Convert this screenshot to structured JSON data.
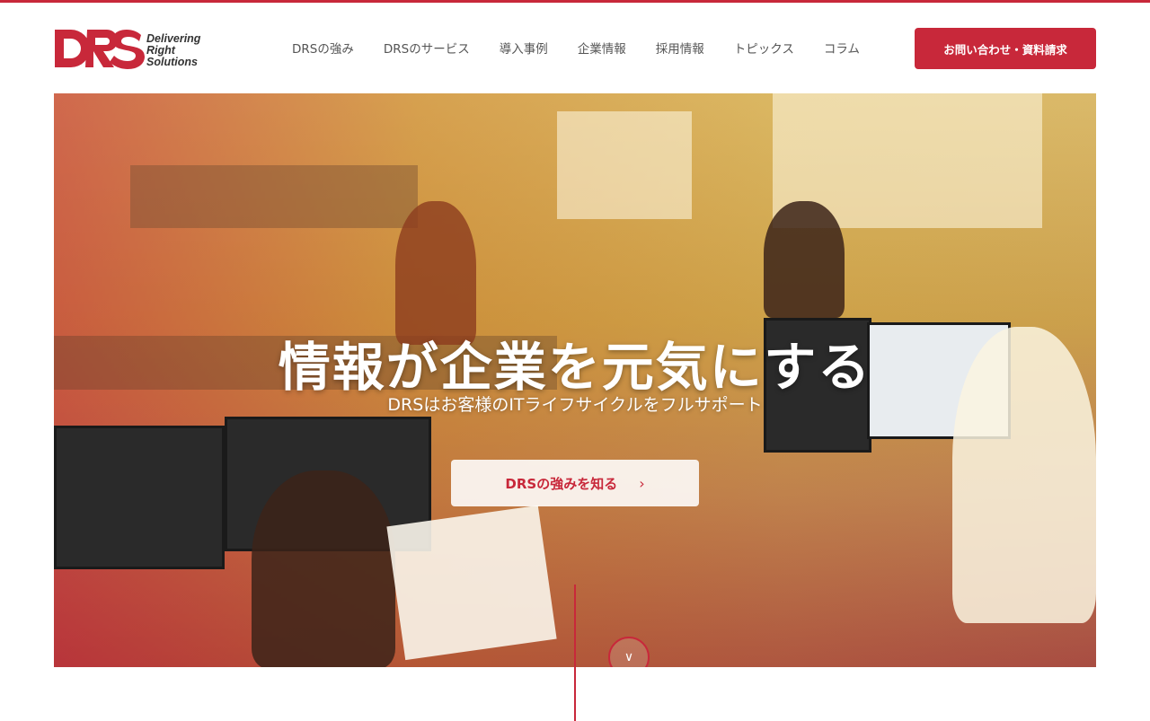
{
  "brand": {
    "logo_text": "DRS",
    "tagline": [
      "Delivering",
      "Right",
      "Solutions"
    ],
    "accent_color": "#c8283a"
  },
  "nav": {
    "items": [
      {
        "label": "DRSの強み"
      },
      {
        "label": "DRSのサービス"
      },
      {
        "label": "導入事例"
      },
      {
        "label": "企業情報"
      },
      {
        "label": "採用情報"
      },
      {
        "label": "トピックス"
      },
      {
        "label": "コラム"
      }
    ],
    "cta_label": "お問い合わせ・資料請求"
  },
  "hero": {
    "title": "情報が企業を元気にする",
    "subtitle": "DRSはお客様のITライフサイクルをフルサポート",
    "button_label": "DRSの強みを知る",
    "button_icon": "chevron-right-icon",
    "scroll_icon": "chevron-down-icon"
  }
}
